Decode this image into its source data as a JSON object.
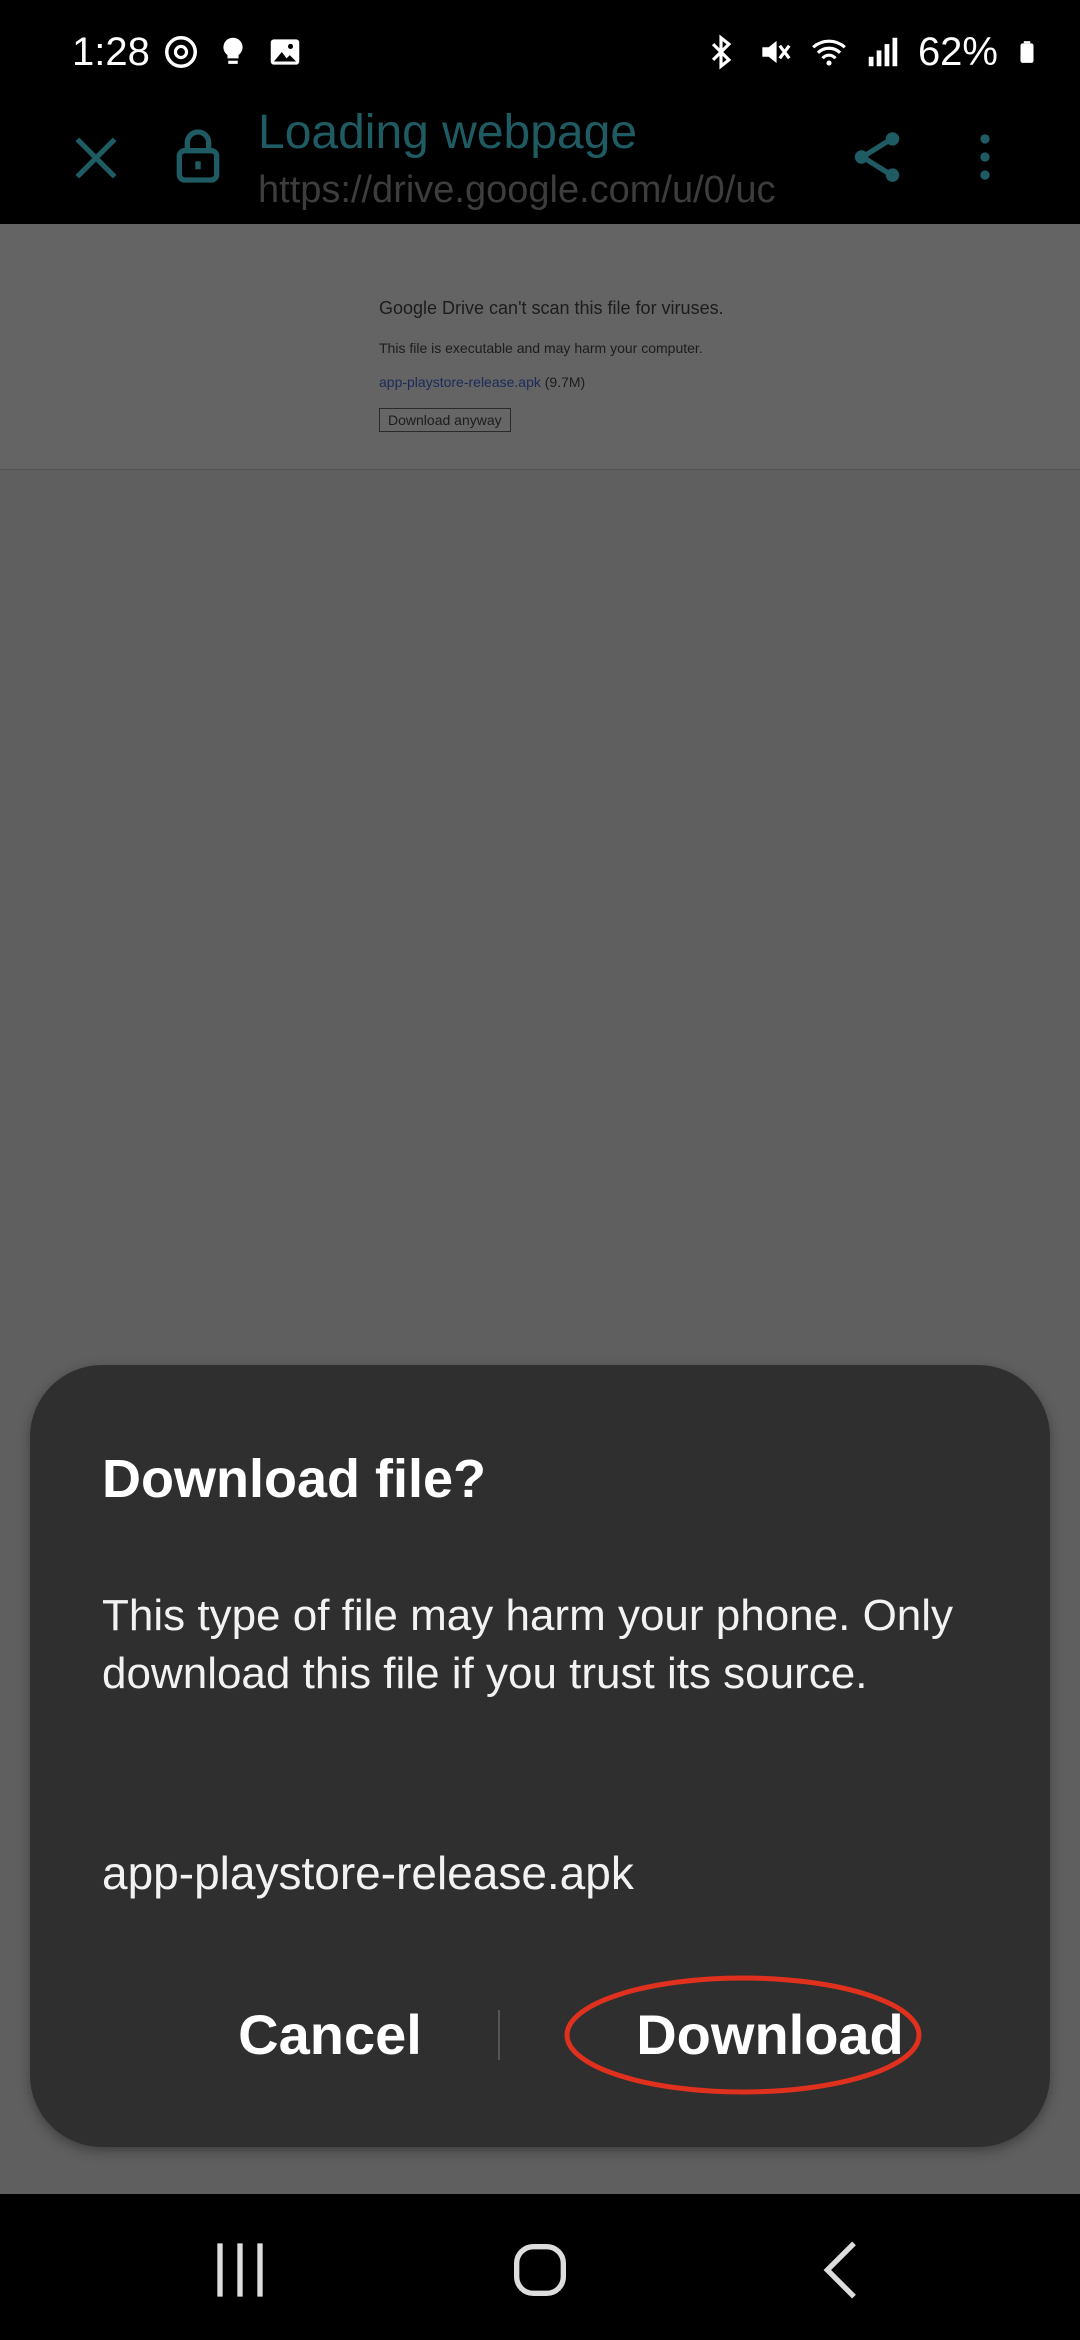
{
  "status_bar": {
    "time": "1:28",
    "battery": "62%",
    "left_icons": [
      "sync-icon",
      "bulb-icon",
      "gallery-icon"
    ],
    "right_icons": [
      "bluetooth-icon",
      "mute-icon",
      "wifi-icon",
      "signal-icon",
      "battery-icon"
    ]
  },
  "toolbar": {
    "title": "Loading webpage",
    "url": "https://drive.google.com/u/0/uc",
    "accent_color": "#1f5b62"
  },
  "web_page": {
    "heading": "Google Drive can't scan this file for viruses.",
    "warning": "This file is executable and may harm your computer.",
    "file_link": "app-playstore-release.apk",
    "file_size": " (9.7M)",
    "button_label": "Download anyway"
  },
  "dialog": {
    "title": "Download file?",
    "message": "This type of file may harm your phone. Only download this file if you trust its source.",
    "filename": "app-playstore-release.apk",
    "cancel_label": "Cancel",
    "download_label": "Download",
    "highlight_color": "#e0301e"
  },
  "nav_bar": {
    "icons": [
      "recents-icon",
      "home-icon",
      "back-icon"
    ]
  }
}
